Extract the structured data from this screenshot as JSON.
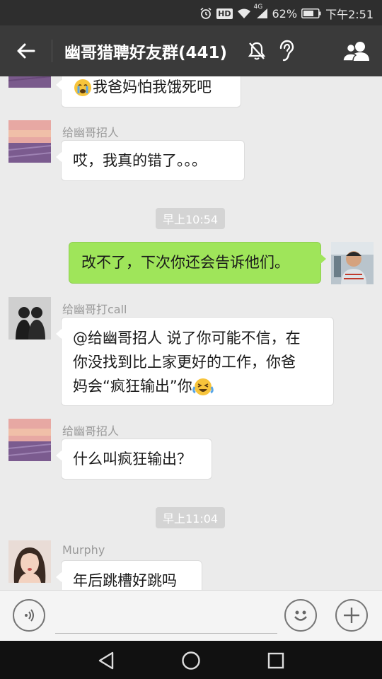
{
  "status_bar": {
    "battery": "62%",
    "time": "下午2:51",
    "hd_label": "HD",
    "network_label": "4G",
    "icons": [
      "alarm-icon",
      "hd-icon",
      "wifi-icon",
      "signal-icon",
      "battery-icon"
    ]
  },
  "header": {
    "title": "幽哥猎聘好友群(441)",
    "icons": [
      "back-arrow-icon",
      "mute-bell-icon",
      "ear-icon",
      "group-members-icon"
    ]
  },
  "messages": [
    {
      "sender": "",
      "text": "我爸妈怕我饿死吧",
      "emoji": "crying-emoji",
      "avatar": "lavender-field-avatar"
    },
    {
      "sender": "给幽哥招人",
      "text": "哎，我真的错了。。。",
      "avatar": "lavender-field-avatar"
    },
    {
      "timestamp": "早上10:54"
    },
    {
      "sender": "",
      "text": "改不了，下次你还会告诉他们。",
      "mine": true,
      "avatar": "man-photo-avatar"
    },
    {
      "sender": "给幽哥打call",
      "text_lines": [
        "@给幽哥招人 说了你可能不信，在",
        "你没找到比上家更好的工作，你爸",
        "妈会“疯狂输出”你"
      ],
      "emoji": "laughing-crying-emoji",
      "avatar": "two-figures-avatar"
    },
    {
      "sender": "给幽哥招人",
      "text": "什么叫疯狂输出？",
      "avatar": "lavender-field-avatar"
    },
    {
      "timestamp": "早上11:04"
    },
    {
      "sender": "Murphy",
      "text": "年后跳槽好跳吗",
      "avatar": "girl-photo-avatar"
    }
  ],
  "input_bar": {
    "value": "",
    "icons": [
      "voice-icon",
      "emoji-icon",
      "plus-icon"
    ]
  },
  "nav_bar": {
    "icons": [
      "nav-back-icon",
      "nav-home-icon",
      "nav-recents-icon"
    ]
  },
  "colors": {
    "my_bubble": "#9fe55a",
    "other_bubble": "#ffffff",
    "chat_bg": "#ebebeb",
    "title_bar": "#3a3a3a"
  }
}
